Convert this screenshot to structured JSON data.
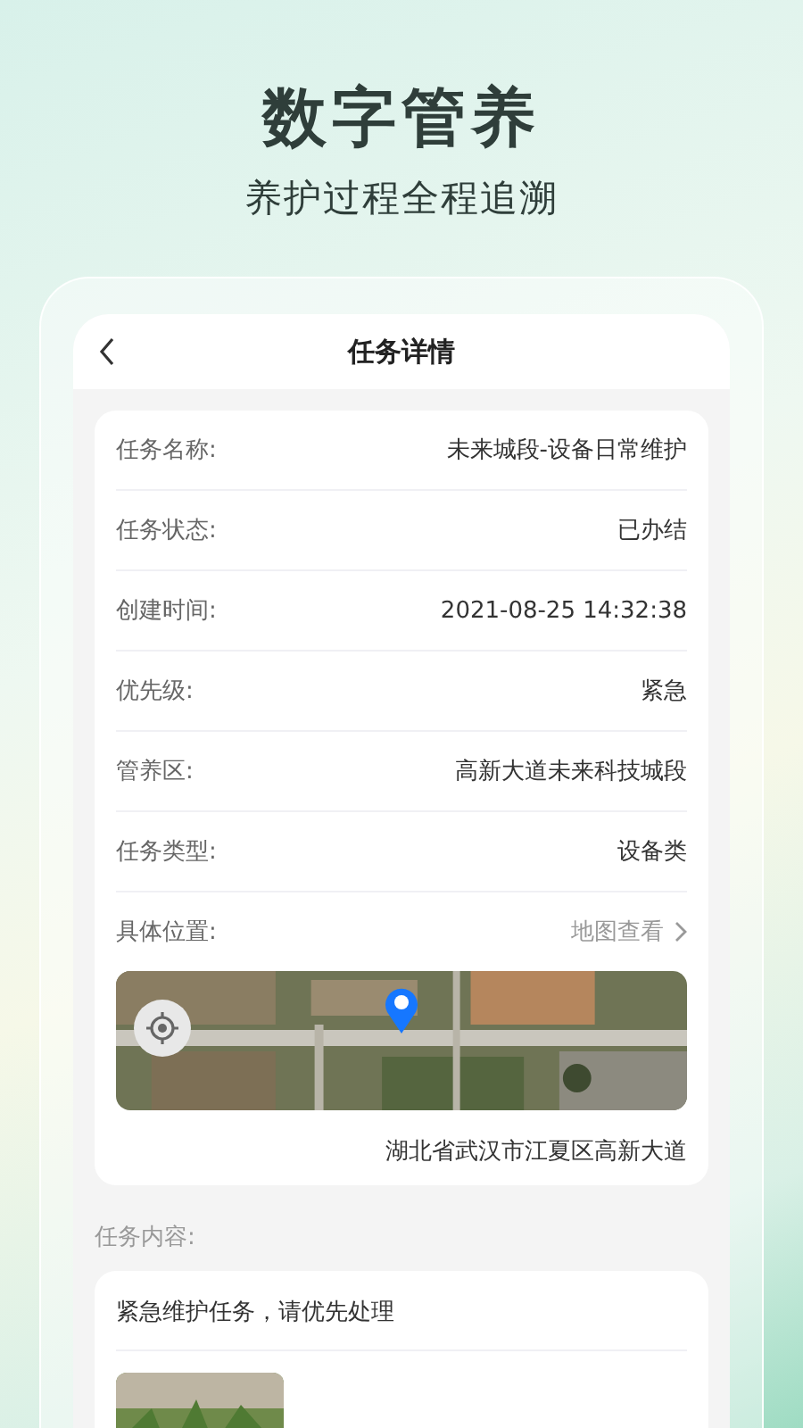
{
  "headline": {
    "title": "数字管养",
    "subtitle": "养护过程全程追溯"
  },
  "screen": {
    "title": "任务详情"
  },
  "fields": [
    {
      "label": "任务名称:",
      "value": "未来城段-设备日常维护"
    },
    {
      "label": "任务状态:",
      "value": "已办结"
    },
    {
      "label": "创建时间:",
      "value": "2021-08-25 14:32:38"
    },
    {
      "label": "优先级:",
      "value": "紧急"
    },
    {
      "label": "管养区:",
      "value": "高新大道未来科技城段"
    },
    {
      "label": "任务类型:",
      "value": "设备类"
    }
  ],
  "location": {
    "label": "具体位置:",
    "link": "地图查看",
    "address": "湖北省武汉市江夏区高新大道"
  },
  "content": {
    "label": "任务内容:",
    "text": "紧急维护任务，请优先处理"
  }
}
